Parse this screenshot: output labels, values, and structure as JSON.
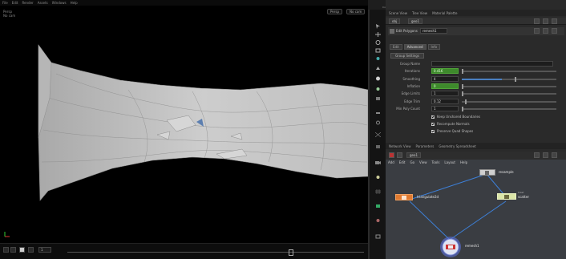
{
  "viewport": {
    "menu": [
      "File",
      "Edit",
      "Render",
      "Assets",
      "Windows",
      "Help"
    ],
    "hud_top_left": [
      "Persp",
      "No cam"
    ],
    "view_buttons": [
      "Persp",
      "No cam"
    ],
    "frame": "1"
  },
  "top_toolbar": {
    "labels": [
      "Cook",
      "Solaris",
      "Render",
      "Light",
      "Pyro",
      "Particles",
      "Fluid",
      "Terrain",
      "Grains",
      "Vellum"
    ]
  },
  "panel_tabs": [
    "Scene View",
    "Tree View",
    "Material Palette"
  ],
  "path": {
    "obj": "obj",
    "geo": "geo1"
  },
  "node": {
    "type": "Edit Polygons",
    "name": "remesh1"
  },
  "sub_tabs": [
    "Edit",
    "Advanced",
    "Info"
  ],
  "group_button": "Group Settings",
  "parms": [
    {
      "label": "Group Name",
      "type": "wide"
    },
    {
      "label": "Iterations",
      "value": "0.416",
      "green": true,
      "fill": 0.0,
      "knob": 0.0
    },
    {
      "label": "Smoothing",
      "value": "4",
      "green": false,
      "fill": 0.42,
      "knob": 0.56
    },
    {
      "label": "Inflation",
      "value": "0",
      "green": true,
      "fill": 0.0,
      "knob": 0.0
    },
    {
      "label": "Edge Limits",
      "value": "1",
      "green": false,
      "fill": 0.0,
      "knob": 0.0
    },
    {
      "label": "Edge Trim",
      "value": "0.12",
      "green": false,
      "fill": 0.0,
      "knob": 0.03
    },
    {
      "label": "Min Poly Count",
      "value": "1",
      "green": false,
      "fill": 0.0,
      "knob": 0.0
    }
  ],
  "checkboxes": [
    "Keep Unshared Boundaries",
    "Recompute Normals",
    "Preserve Quad Shapes"
  ],
  "network": {
    "tabs": [
      "Network View",
      "Parameters",
      "Geometry Spreadsheet"
    ],
    "path": "geo1",
    "menu": [
      "Add",
      "Edit",
      "Go",
      "View",
      "Tools",
      "Layout",
      "Help"
    ],
    "nodes": {
      "top": "resample",
      "left": "triangulate2d",
      "right": "scatter",
      "right_sub": "blast",
      "bottom": "remesh1"
    }
  },
  "colors": {
    "green_field": "#3e8a2c",
    "blue_slider": "#4a7fc0",
    "orange_node": "#e07a30",
    "wire": "#3d7fd6"
  }
}
